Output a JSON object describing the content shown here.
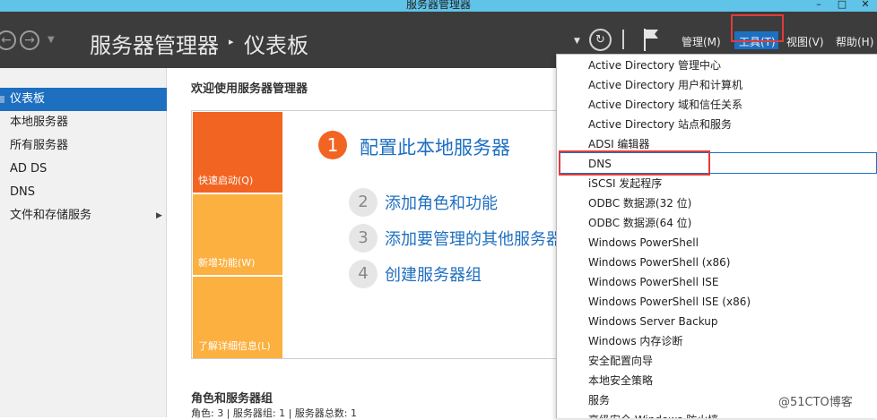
{
  "window": {
    "title": "服务器管理器",
    "min": "–",
    "max": "□",
    "close": "✕"
  },
  "header": {
    "breadcrumb_root": "服务器管理器",
    "breadcrumb_sep": "▸",
    "breadcrumb_page": "仪表板",
    "menus": {
      "manage": "管理(M)",
      "tools": "工具(T)",
      "view": "视图(V)",
      "help": "帮助(H)"
    },
    "icons": {
      "back": "back-arrow-icon",
      "forward": "forward-arrow-icon",
      "refresh": "refresh-icon",
      "flag": "notification-flag-icon"
    },
    "accent": "#1e6fc0"
  },
  "sidebar": {
    "items": [
      {
        "label": "仪表板",
        "active": true
      },
      {
        "label": "本地服务器"
      },
      {
        "label": "所有服务器"
      },
      {
        "label": "AD DS"
      },
      {
        "label": "DNS"
      },
      {
        "label": "文件和存储服务",
        "has_submenu": true
      }
    ]
  },
  "main": {
    "welcome": "欢迎使用服务器管理器",
    "tiles": {
      "quick_start": "快速启动(Q)",
      "whats_new": "新增功能(W)",
      "learn_more": "了解详细信息(L)"
    },
    "steps": [
      {
        "num": "1",
        "label": "配置此本地服务器"
      },
      {
        "num": "2",
        "label": "添加角色和功能"
      },
      {
        "num": "3",
        "label": "添加要管理的其他服务器"
      },
      {
        "num": "4",
        "label": "创建服务器组"
      }
    ],
    "roles_title": "角色和服务器组",
    "roles_summary": "角色: 3 | 服务器组: 1 | 服务器总数: 1"
  },
  "tools_menu": {
    "items": [
      "Active Directory 管理中心",
      "Active Directory 用户和计算机",
      "Active Directory 域和信任关系",
      "Active Directory 站点和服务",
      "ADSI 编辑器",
      "DNS",
      "iSCSI 发起程序",
      "ODBC 数据源(32 位)",
      "ODBC 数据源(64 位)",
      "Windows PowerShell",
      "Windows PowerShell (x86)",
      "Windows PowerShell ISE",
      "Windows PowerShell ISE (x86)",
      "Windows Server Backup",
      "Windows 内存诊断",
      "安全配置向导",
      "本地安全策略",
      "服务",
      "高级安全 Windows 防火墙"
    ],
    "highlighted": "DNS"
  },
  "watermark": "@51CTO博客",
  "colors": {
    "orange": "#f26422",
    "amber": "#fbb040",
    "annotation_red": "#e03c3c"
  }
}
